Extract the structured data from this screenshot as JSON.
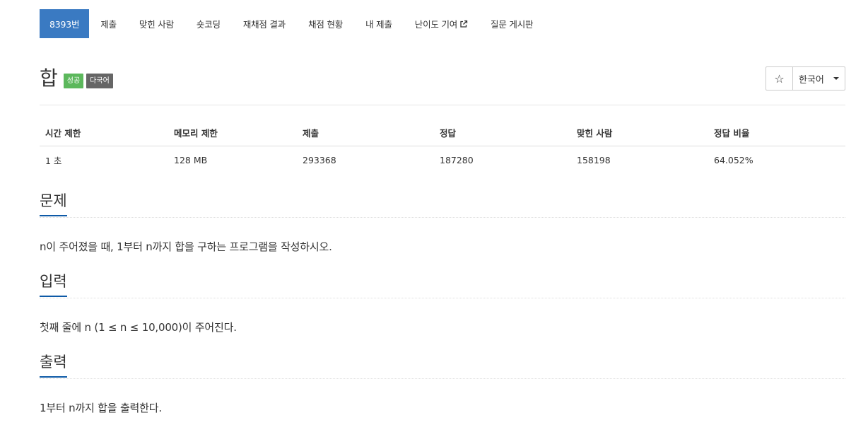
{
  "tabs": [
    {
      "label": "8393번",
      "active": true
    },
    {
      "label": "제출"
    },
    {
      "label": "맞힌 사람"
    },
    {
      "label": "숏코딩"
    },
    {
      "label": "재채점 결과"
    },
    {
      "label": "채점 현황"
    },
    {
      "label": "내 제출"
    },
    {
      "label": "난이도 기여",
      "external": true
    },
    {
      "label": "질문 게시판"
    }
  ],
  "problem": {
    "title": "합",
    "badges": {
      "success": "성공",
      "multilang": "다국어"
    }
  },
  "actions": {
    "star_icon": "☆",
    "language": "한국어"
  },
  "info_table": {
    "headers": [
      "시간 제한",
      "메모리 제한",
      "제출",
      "정답",
      "맞힌 사람",
      "정답 비율"
    ],
    "row": [
      "1 초",
      "128 MB",
      "293368",
      "187280",
      "158198",
      "64.052%"
    ]
  },
  "sections": {
    "description": {
      "heading": "문제",
      "text": "n이 주어졌을 때, 1부터 n까지 합을 구하는 프로그램을 작성하시오."
    },
    "input": {
      "heading": "입력",
      "text": "첫째 줄에 n (1 ≤ n ≤ 10,000)이 주어진다."
    },
    "output": {
      "heading": "출력",
      "text": "1부터 n까지 합을 출력한다."
    }
  },
  "colors": {
    "active_tab": "#3a7ac2",
    "success_badge": "#5cb85c",
    "multilang_badge": "#666666",
    "section_underline": "#0e5aa7"
  }
}
